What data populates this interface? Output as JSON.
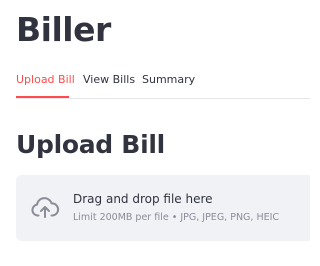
{
  "app": {
    "title": "Biller"
  },
  "tabs": [
    {
      "label": "Upload Bill",
      "active": true
    },
    {
      "label": "View Bills",
      "active": false
    },
    {
      "label": "Summary",
      "active": false
    }
  ],
  "main": {
    "section_title": "Upload Bill",
    "uploader": {
      "instruction": "Drag and drop file here",
      "limit_text": "Limit 200MB per file • JPG, JPEG, PNG, HEIC",
      "icon": "cloud-upload-icon"
    }
  },
  "colors": {
    "accent": "#ff4b4b",
    "text": "#31333f",
    "muted_text": "#8a8d97",
    "dropzone_bg": "#f0f2f6"
  }
}
